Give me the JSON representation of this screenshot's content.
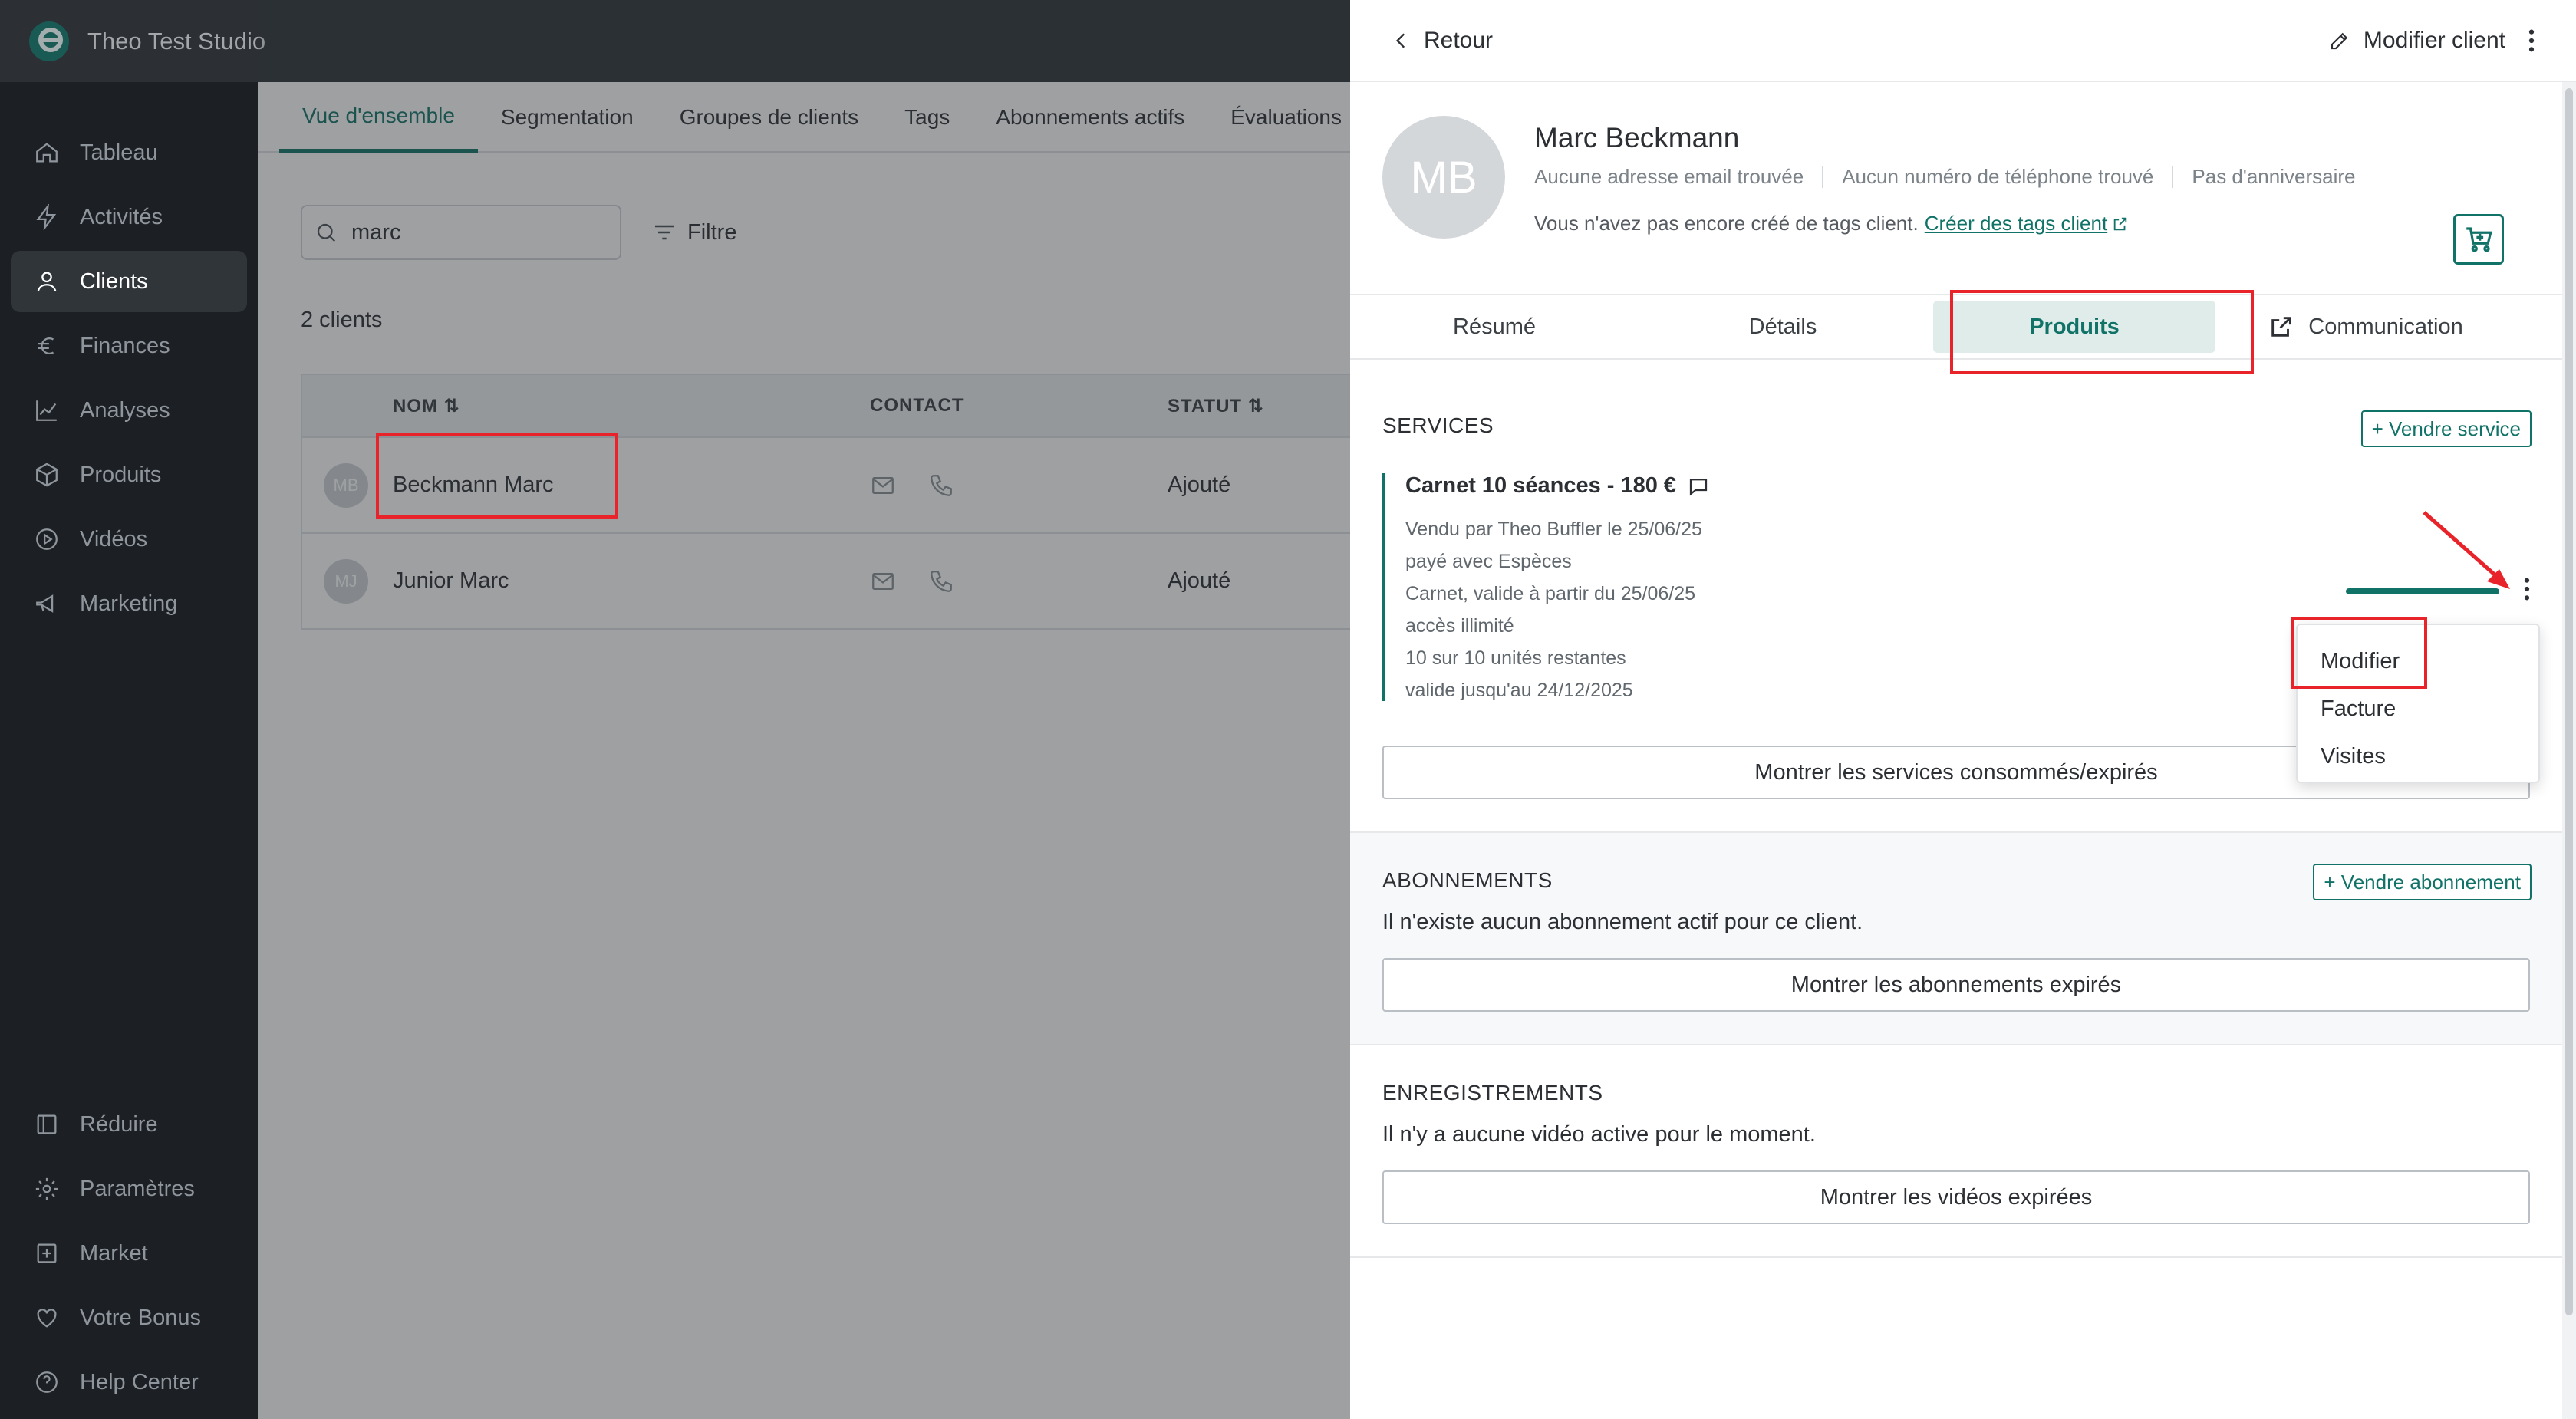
{
  "app": {
    "title": "Theo Test Studio"
  },
  "sidebar": {
    "items": [
      {
        "label": "Tableau",
        "icon": "home-icon"
      },
      {
        "label": "Activités",
        "icon": "lightning-icon"
      },
      {
        "label": "Clients",
        "icon": "user-icon",
        "active": true
      },
      {
        "label": "Finances",
        "icon": "euro-icon"
      },
      {
        "label": "Analyses",
        "icon": "chart-icon"
      },
      {
        "label": "Produits",
        "icon": "box-icon"
      },
      {
        "label": "Vidéos",
        "icon": "play-icon"
      },
      {
        "label": "Marketing",
        "icon": "megaphone-icon"
      }
    ],
    "bottom_items": [
      {
        "label": "Réduire",
        "icon": "collapse-icon"
      },
      {
        "label": "Paramètres",
        "icon": "gear-icon"
      },
      {
        "label": "Market",
        "icon": "plus-square-icon"
      },
      {
        "label": "Votre Bonus",
        "icon": "heart-icon"
      },
      {
        "label": "Help Center",
        "icon": "help-icon"
      }
    ]
  },
  "main": {
    "tabs": [
      {
        "label": "Vue d'ensemble",
        "active": true
      },
      {
        "label": "Segmentation"
      },
      {
        "label": "Groupes de clients"
      },
      {
        "label": "Tags"
      },
      {
        "label": "Abonnements actifs"
      },
      {
        "label": "Évaluations"
      }
    ],
    "search_value": "marc",
    "filter_label": "Filtre",
    "count": "2 clients",
    "columns": {
      "name": "NOM",
      "contact": "CONTACT",
      "status": "STATUT"
    },
    "rows": [
      {
        "initials": "MB",
        "name": "Beckmann Marc",
        "status": "Ajouté"
      },
      {
        "initials": "MJ",
        "name": "Junior Marc",
        "status": "Ajouté"
      }
    ]
  },
  "panel": {
    "back_label": "Retour",
    "edit_label": "Modifier client",
    "client": {
      "initials": "MB",
      "name": "Marc Beckmann",
      "email": "Aucune adresse email trouvée",
      "phone": "Aucun numéro de téléphone trouvé",
      "birthday": "Pas d'anniversaire",
      "tags_text": "Vous n'avez pas encore créé de tags client.",
      "tags_link": "Créer des tags client"
    },
    "tabs": [
      {
        "label": "Résumé"
      },
      {
        "label": "Détails"
      },
      {
        "label": "Produits",
        "active": true
      },
      {
        "label": "Communication"
      }
    ],
    "services": {
      "title": "SERVICES",
      "sell_button": "+ Vendre service",
      "card": {
        "title": "Carnet 10 séances - 180 €",
        "lines": [
          "Vendu par Theo Buffler le 25/06/25",
          "payé avec Espèces",
          "Carnet, valide à partir du 25/06/25",
          "accès illimité",
          "10 sur 10 unités restantes",
          "valide jusqu'au 24/12/2025"
        ],
        "remaining_fraction": 1.0
      },
      "show_button": "Montrer les services consommés/expirés"
    },
    "subscriptions": {
      "title": "ABONNEMENTS",
      "sell_button": "+ Vendre abonnement",
      "empty": "Il n'existe aucun abonnement actif pour ce client.",
      "show_button": "Montrer les abonnements expirés"
    },
    "recordings": {
      "title": "ENREGISTREMENTS",
      "empty": "Il n'y a aucune vidéo active pour le moment.",
      "show_button": "Montrer les vidéos expirées"
    },
    "dropdown": [
      "Modifier",
      "Facture",
      "Visites"
    ]
  },
  "colors": {
    "accent": "#117368",
    "sidebar": "#1c1f23",
    "annotation": "#e8242a"
  }
}
